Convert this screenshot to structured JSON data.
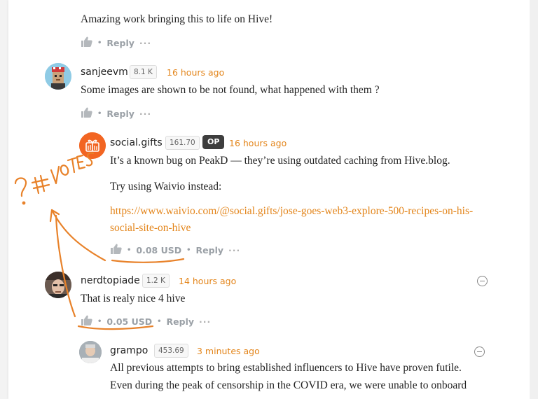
{
  "comments": [
    {
      "text": "Amazing work bringing this to life on Hive!",
      "reply_label": "Reply",
      "more_label": "···"
    },
    {
      "author": "sanjeevm",
      "reputation": "8.1 K",
      "time": "16 hours ago",
      "text": "Some images are shown to be not found, what happened with them ?",
      "reply_label": "Reply",
      "more_label": "···"
    },
    {
      "author": "social.gifts",
      "reputation": "161.70",
      "op_badge": "OP",
      "time": "16 hours ago",
      "text_line1": "It’s a known bug on PeakD — they’re using outdated caching from Hive.blog.",
      "text_line2": "Try using Waivio instead:",
      "link_line1": "https://www.waivio.com/@social.gifts/jose-goes-web3-explore-500-recipes-on-his-",
      "link_line2": "social-site-on-hive",
      "payout": "0.08 USD",
      "reply_label": "Reply",
      "more_label": "···"
    },
    {
      "author": "nerdtopiade",
      "reputation": "1.2 K",
      "time": "14 hours ago",
      "text": "That is realy nice 4 hive",
      "payout": "0.05 USD",
      "reply_label": "Reply",
      "more_label": "···"
    },
    {
      "author": "grampo",
      "reputation": "453.69",
      "time": "3 minutes ago",
      "text_line1": "All previous attempts to bring established influencers to Hive have proven futile.",
      "text_line2": "Even during the peak of censorship in the COVID era, we were unable to onboard"
    }
  ],
  "annotation": {
    "handwriting": "? #VOTES",
    "color": "#e8822a"
  },
  "colors": {
    "accent": "#e3851b",
    "muted": "#9aa0a6",
    "op_badge_bg": "#3e3e3e"
  }
}
